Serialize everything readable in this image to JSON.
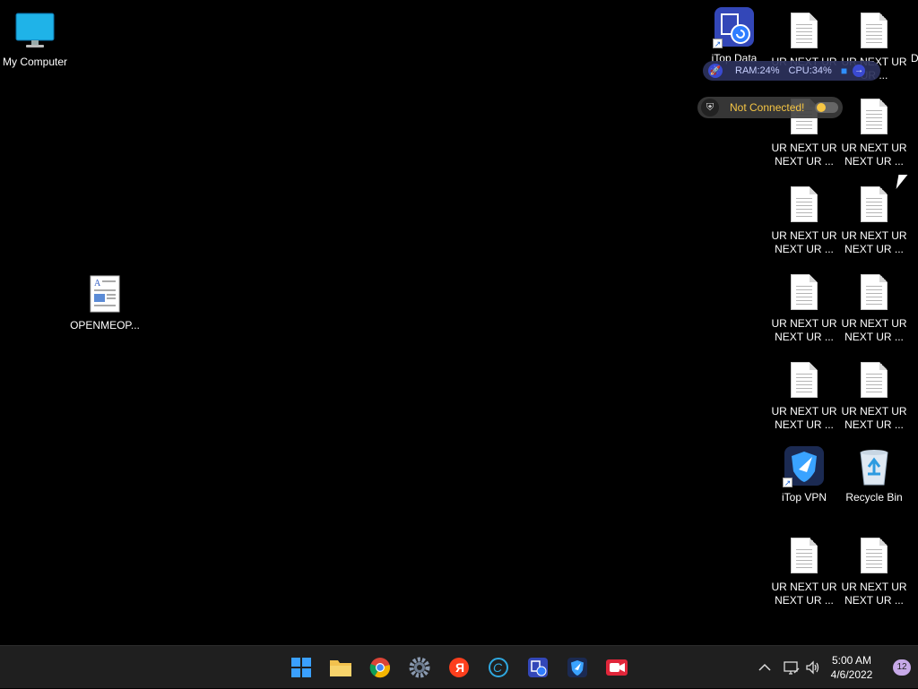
{
  "desktop": {
    "my_computer": "My Computer",
    "openmeop": "OPENMEOP...",
    "itop_data": "iTop Data",
    "file_label": "UR NEXT UR\nNEXT UR ...",
    "file_label_top": "UR NEXT UR",
    "file_label_top2": "UR NEXT UR\nUR ...",
    "itop_vpn": "iTop VPN",
    "recycle_bin": "Recycle Bin",
    "edge_letter": "D"
  },
  "perf": {
    "ram": "RAM:24%",
    "cpu": "CPU:34%"
  },
  "vpn_status": "Not Connected!",
  "taskbar": {
    "time": "5:00 AM",
    "date": "4/6/2022",
    "notifications": "12",
    "apps": [
      "start",
      "file-explorer",
      "chrome",
      "settings",
      "yandex",
      "ccleaner",
      "itop-data-recovery",
      "itop-vpn",
      "screen-recorder"
    ]
  },
  "colors": {
    "desktop_bg": "#000000",
    "taskbar_bg": "#1f1f1f",
    "vpn_text": "#f6c644"
  }
}
